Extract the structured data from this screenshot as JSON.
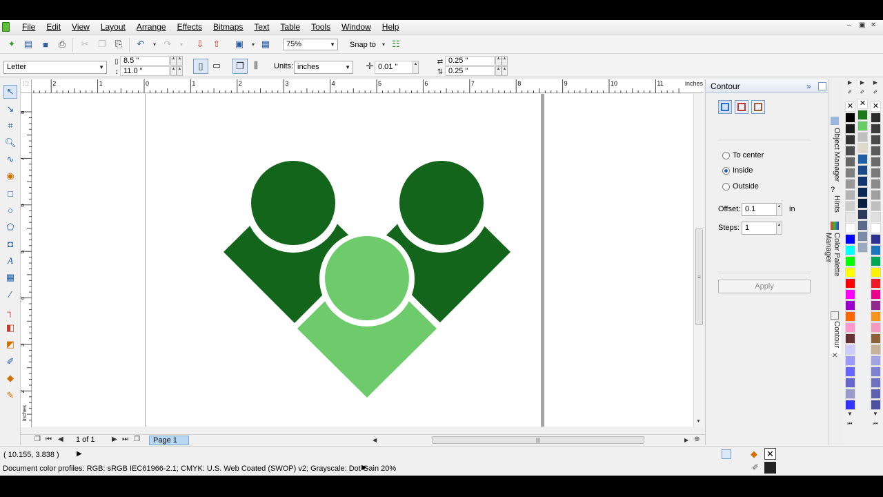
{
  "menubar": {
    "items": [
      "File",
      "Edit",
      "View",
      "Layout",
      "Arrange",
      "Effects",
      "Bitmaps",
      "Text",
      "Table",
      "Tools",
      "Window",
      "Help"
    ]
  },
  "toolbar1": {
    "zoom": "75%",
    "snap": "Snap to"
  },
  "property_bar": {
    "paper": "Letter",
    "width": "8.5 \"",
    "height": "11.0 \"",
    "units_label": "Units:",
    "units": "inches",
    "nudge": "0.01 \"",
    "dup_x": "0.25 \"",
    "dup_y": "0.25 \""
  },
  "ruler": {
    "unit": "inches",
    "h_labels": [
      "2",
      "1",
      "0",
      "1",
      "2",
      "3",
      "4",
      "5",
      "6",
      "7",
      "8",
      "9",
      "10",
      "11"
    ],
    "v_labels": [
      "8",
      "7",
      "6",
      "5",
      "4",
      "3",
      "2",
      "1"
    ]
  },
  "artwork": {
    "dark_green": "#13651b",
    "light_green": "#6dcb6c"
  },
  "pagebar": {
    "counter": "1 of 1",
    "page_tab": "Page 1"
  },
  "docker": {
    "title": "Contour",
    "options": [
      "To center",
      "Inside",
      "Outside"
    ],
    "selected": "Inside",
    "offset_label": "Offset:",
    "offset": "0.1",
    "offset_unit": "in",
    "steps_label": "Steps:",
    "steps": "1",
    "apply": "Apply"
  },
  "side_tabs": [
    "Object Manager",
    "Hints",
    "Color Palette Manager",
    "Contour"
  ],
  "status": {
    "coords": "( 10.155, 3.838 )",
    "profiles": "Document color profiles: RGB: sRGB IEC61966-2.1; CMYK: U.S. Web Coated (SWOP) v2; Grayscale: Dot Gain 20%"
  },
  "palette1": [
    "#000000",
    "#1a1a1a",
    "#333333",
    "#4d4d4d",
    "#666666",
    "#808080",
    "#999999",
    "#b3b3b3",
    "#cccccc",
    "#e6e6e6",
    "#ffffff",
    "#0000ff",
    "#00ffff",
    "#00ff00",
    "#ffff00",
    "#ff0000",
    "#ff00ff",
    "#9900cc",
    "#ff6600",
    "#ff99cc",
    "#663333",
    "#ccccff",
    "#9999ff",
    "#6666ff",
    "#6666cc",
    "#9999cc",
    "#3333ff"
  ],
  "palette2": [
    "#1a7a1a",
    "#66cc66",
    "#bfbfbf",
    "#ded9c8",
    "#1f5fa8",
    "#1a4a8a",
    "#10386e",
    "#0a2a55",
    "#0a1f40",
    "#2a3a5a",
    "#5a6a8a",
    "#7a8aa8",
    "#9aa8c0"
  ],
  "palette3": [
    "#2b2b2b",
    "#3b3b3b",
    "#4b4b4b",
    "#5b5b5b",
    "#6b6b6b",
    "#7b7b7b",
    "#8b8b8b",
    "#a0a0a0",
    "#c0c0c0",
    "#e0e0e0",
    "#ffffff",
    "#2e3192",
    "#1c75bc",
    "#00a651",
    "#fff200",
    "#ed1c24",
    "#ec008c",
    "#92278f",
    "#f7941d",
    "#f49ac1",
    "#8c6239",
    "#c7b299",
    "#a3a3e0",
    "#8080d0",
    "#7070c0",
    "#6060b0",
    "#5050a0"
  ]
}
